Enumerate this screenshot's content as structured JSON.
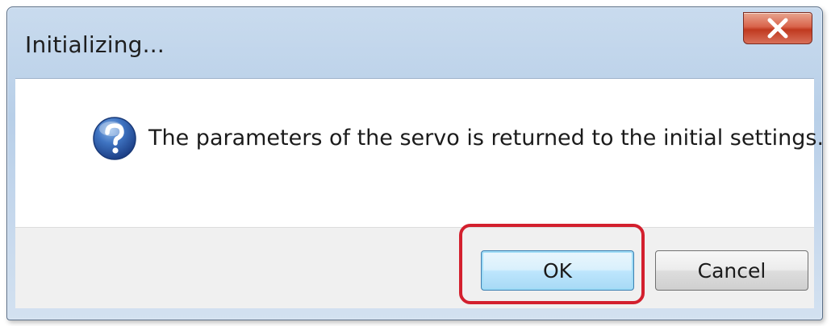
{
  "dialog": {
    "title": "Initializing...",
    "close_icon": "close-icon",
    "message_icon": "question-icon",
    "message": "The parameters of the servo is returned to the initial settings.OK?"
  },
  "buttons": {
    "ok_label": "OK",
    "cancel_label": "Cancel"
  },
  "colors": {
    "highlight": "#d3202e",
    "close_button": "#c0391f",
    "question_icon": "#2a5fa8"
  }
}
